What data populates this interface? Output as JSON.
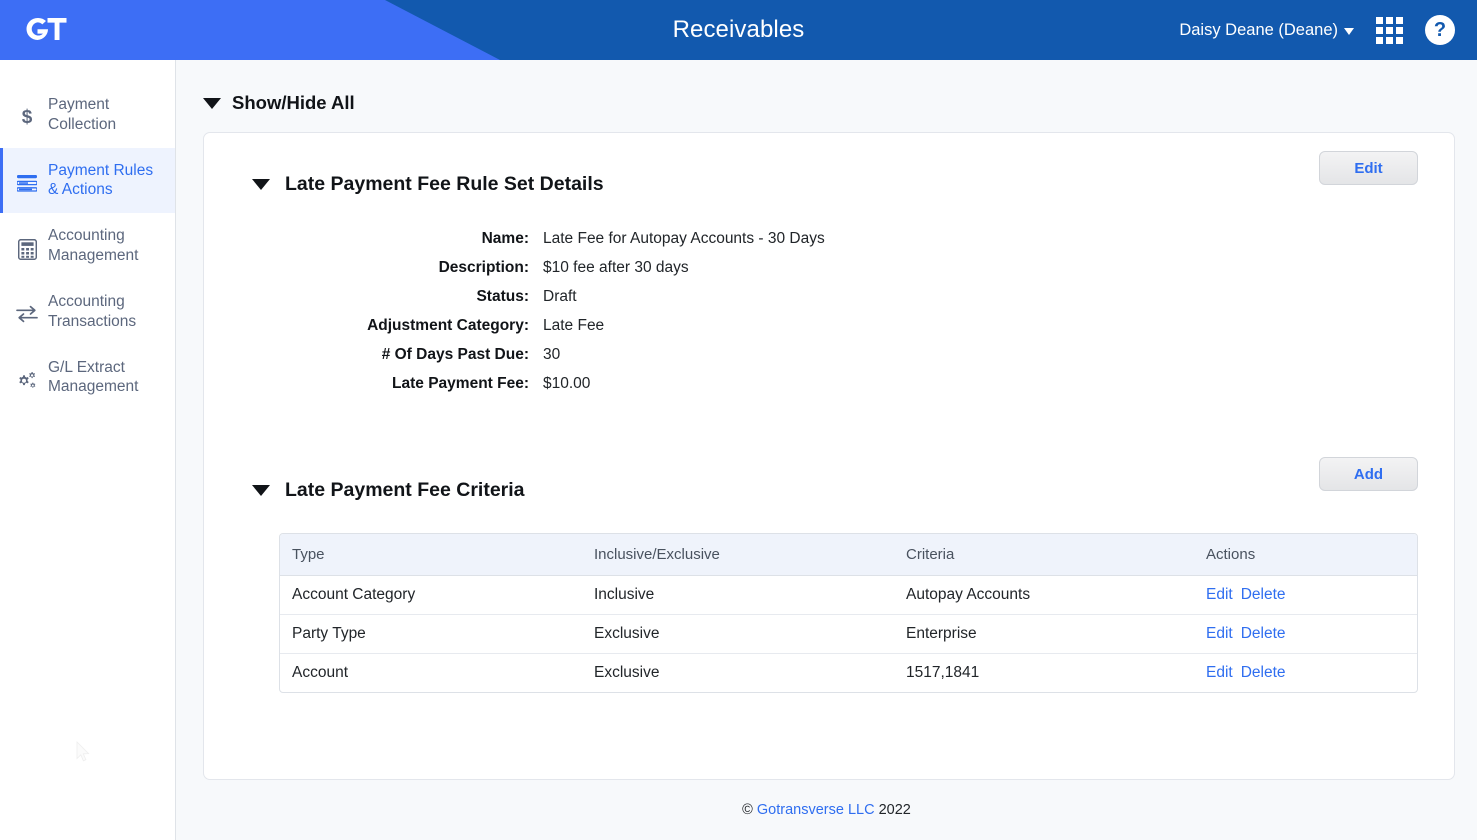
{
  "header": {
    "logo_text": "GT",
    "title": "Receivables",
    "user_name": "Daisy Deane (Deane)",
    "apps_icon": "apps-grid-icon",
    "help_icon": "help-question-icon",
    "bg_color": "#1259ae",
    "accent_color": "#3d6ef5"
  },
  "sidebar": {
    "items": [
      {
        "label": "Payment Collection",
        "icon": "dollar-icon",
        "active": false
      },
      {
        "label": "Payment Rules & Actions",
        "icon": "rules-lines-icon",
        "active": true
      },
      {
        "label": "Accounting Management",
        "icon": "calculator-icon",
        "active": false
      },
      {
        "label": "Accounting Transactions",
        "icon": "transfer-arrows-icon",
        "active": false
      },
      {
        "label": "G/L Extract Management",
        "icon": "gears-icon",
        "active": false
      }
    ]
  },
  "main": {
    "show_hide_all": "Show/Hide All",
    "details": {
      "title": "Late Payment Fee Rule Set Details",
      "edit_label": "Edit",
      "fields": [
        {
          "label": "Name:",
          "value": "Late Fee for Autopay Accounts - 30 Days"
        },
        {
          "label": "Description:",
          "value": "$10 fee after 30 days"
        },
        {
          "label": "Status:",
          "value": "Draft"
        },
        {
          "label": "Adjustment Category:",
          "value": "Late Fee"
        },
        {
          "label": "# Of Days Past Due:",
          "value": "30"
        },
        {
          "label": "Late Payment Fee:",
          "value": "$10.00"
        }
      ]
    },
    "criteria": {
      "title": "Late Payment Fee Criteria",
      "add_label": "Add",
      "columns": [
        "Type",
        "Inclusive/Exclusive",
        "Criteria",
        "Actions"
      ],
      "rows": [
        {
          "type": "Account Category",
          "inclusive": "Inclusive",
          "criteria": "Autopay Accounts",
          "edit": "Edit",
          "delete": "Delete"
        },
        {
          "type": "Party Type",
          "inclusive": "Exclusive",
          "criteria": "Enterprise",
          "edit": "Edit",
          "delete": "Delete"
        },
        {
          "type": "Account",
          "inclusive": "Exclusive",
          "criteria": "1517,1841",
          "edit": "Edit",
          "delete": "Delete"
        }
      ]
    }
  },
  "footer": {
    "copyright_symbol": "©",
    "company": "Gotransverse LLC",
    "year": "2022"
  }
}
